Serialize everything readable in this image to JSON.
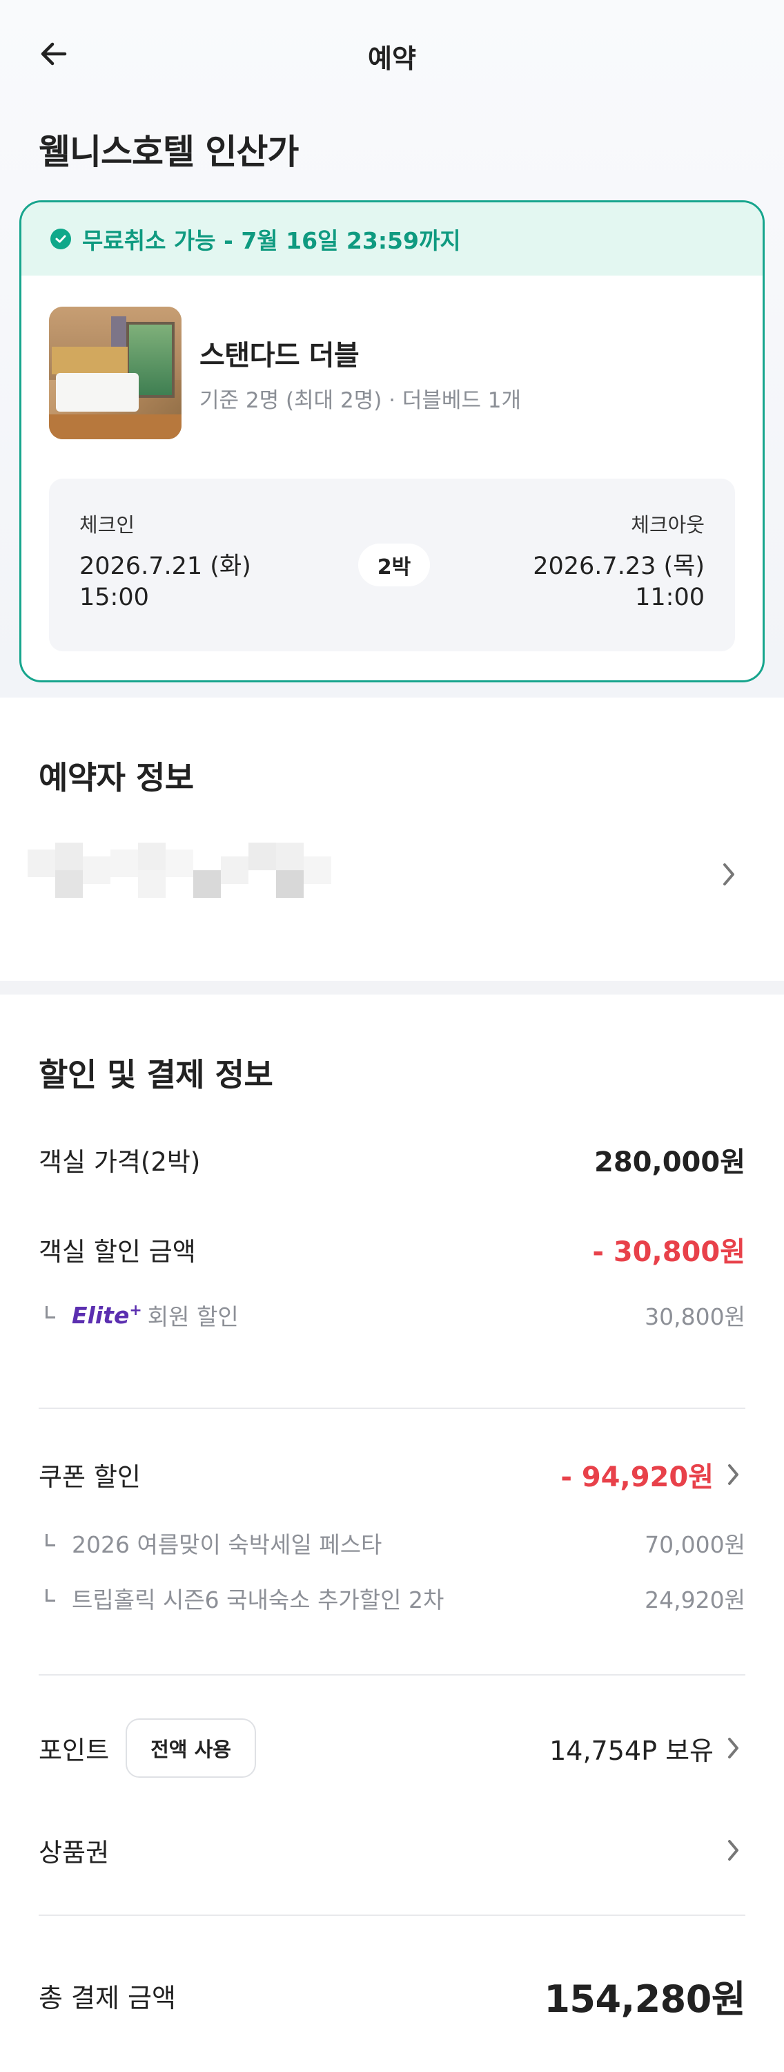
{
  "appbar": {
    "title": "예약"
  },
  "hotel": {
    "name": "웰니스호텔 인산가"
  },
  "card": {
    "cancel_notice": "무료취소 가능 - 7월 16일 23:59까지",
    "room_name": "스탠다드 더블",
    "room_meta": "기준 2명 (최대 2명) · 더블베드 1개",
    "checkin_label": "체크인",
    "checkin_date": "2026.7.21 (화)",
    "checkin_time": "15:00",
    "nights": "2박",
    "checkout_label": "체크아웃",
    "checkout_date": "2026.7.23 (목)",
    "checkout_time": "11:00"
  },
  "booker": {
    "title": "예약자 정보"
  },
  "payment": {
    "title": "할인 및 결제 정보",
    "room_price_label": "객실 가격(2박)",
    "room_price_value": "280,000원",
    "room_discount_label": "객실 할인 금액",
    "room_discount_value": "- 30,800원",
    "elite_badge": "Elite",
    "elite_plus": "+",
    "member_discount_label": "회원 할인",
    "member_discount_value": "30,800원",
    "coupon_label": "쿠폰 할인",
    "coupon_value": "- 94,920원",
    "coupons": [
      {
        "label": "2026 여름맞이 숙박세일 페스타",
        "value": "70,000원"
      },
      {
        "label": "트립홀릭 시즌6 국내숙소 추가할인 2차",
        "value": "24,920원"
      }
    ],
    "point_label": "포인트",
    "point_use_all": "전액 사용",
    "point_value": "14,754P 보유",
    "voucher_label": "상품권",
    "total_label": "총 결제 금액",
    "total_value": "154,280원"
  },
  "colors": {
    "accent": "#17a58d",
    "cancel_bg": "#e3f7f1",
    "discount_red": "#e8414a",
    "elite_purple": "#5b2fb0"
  },
  "icons": [
    "back-arrow-icon",
    "check-circle-icon",
    "chevron-right-icon"
  ]
}
